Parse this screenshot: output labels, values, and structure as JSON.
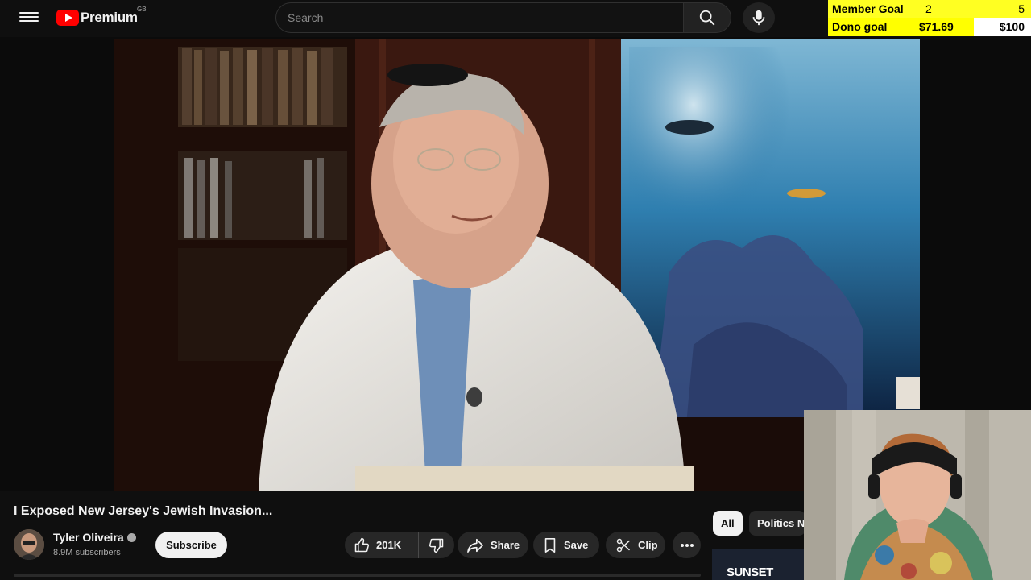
{
  "header": {
    "logo_text": "Premium",
    "logo_region": "GB",
    "search_placeholder": "Search"
  },
  "overlay": {
    "member_goal_label": "Member Goal",
    "member_goal_current": "2",
    "member_goal_target": "5",
    "dono_goal_label": "Dono goal",
    "dono_goal_current": "$71.69",
    "dono_goal_target": "$100",
    "dono_progress": 0.7169
  },
  "video": {
    "title": "I Exposed New Jersey's Jewish Invasion...",
    "channel_name": "Tyler Oliveira",
    "subscribers": "8.9M subscribers",
    "subscribe_label": "Subscribe",
    "likes": "201K",
    "share_label": "Share",
    "save_label": "Save",
    "clip_label": "Clip"
  },
  "sidebar": {
    "chips": [
      "All",
      "Politics N"
    ],
    "rec_thumb_text": "SUNSET"
  },
  "colors": {
    "brand_red": "#ff0000",
    "goal_yellow": "#ffff00",
    "background": "#0f0f0f"
  }
}
